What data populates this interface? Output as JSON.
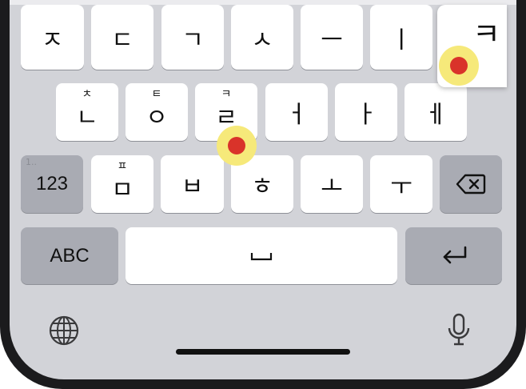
{
  "keyboard": {
    "row1": [
      "ㅈ",
      "ㄷ",
      "ㄱ",
      "ㅅ",
      "ㅡ",
      "ㅣ"
    ],
    "row2": [
      {
        "main": "ㄴ",
        "sub": "ㅊ"
      },
      {
        "main": "ㅇ",
        "sub": "ㅌ"
      },
      {
        "main": "ㄹ",
        "sub": "ㅋ"
      },
      {
        "main": "ㅓ",
        "sub": ""
      },
      {
        "main": "ㅏ",
        "sub": ""
      },
      {
        "main": "ㅔ",
        "sub": ""
      }
    ],
    "row3": [
      {
        "main": "ㅁ",
        "sub": "ㅍ"
      },
      {
        "main": "ㅂ",
        "sub": ""
      },
      {
        "main": "ㅎ",
        "sub": ""
      },
      {
        "main": "ㅗ",
        "sub": ""
      },
      {
        "main": "ㅜ",
        "sub": ""
      }
    ],
    "num_key": "123",
    "num_hint": "1..",
    "abc_key": "ABC",
    "space_glyph": "␣",
    "popup_char": "ㅋ"
  },
  "icons": {
    "backspace": "backspace-icon",
    "return": "return-icon",
    "globe": "globe-icon",
    "mic": "microphone-icon"
  },
  "colors": {
    "keyboard_bg": "#d2d3d8",
    "key": "#ffffff",
    "function_key": "#a9abb3",
    "tap_outer": "#f6e97a",
    "tap_inner": "#d9332a"
  }
}
